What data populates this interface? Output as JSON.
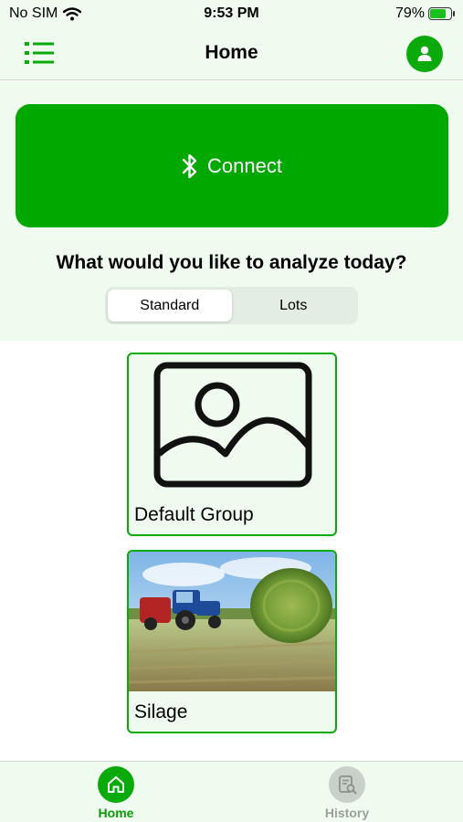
{
  "status_bar": {
    "carrier": "No SIM",
    "time": "9:53 PM",
    "battery": "79%",
    "battery_level": 0.79
  },
  "header": {
    "title": "Home",
    "menu_icon": "list-icon",
    "profile_icon": "user-icon"
  },
  "connect": {
    "label": "Connect",
    "icon": "bluetooth-icon"
  },
  "prompt": "What would you like to analyze today?",
  "segments": {
    "selected": "Standard",
    "options": [
      "Standard",
      "Lots"
    ]
  },
  "groups": [
    {
      "name": "Default Group",
      "image": "image-placeholder-icon"
    },
    {
      "name": "Silage",
      "image": "silage-photo"
    }
  ],
  "tabs": [
    {
      "label": "Home",
      "icon": "home-icon",
      "active": true
    },
    {
      "label": "History",
      "icon": "history-icon",
      "active": false
    }
  ],
  "colors": {
    "accent": "#00a800",
    "background_tint": "#eefbee",
    "inactive": "#9aa19a"
  }
}
